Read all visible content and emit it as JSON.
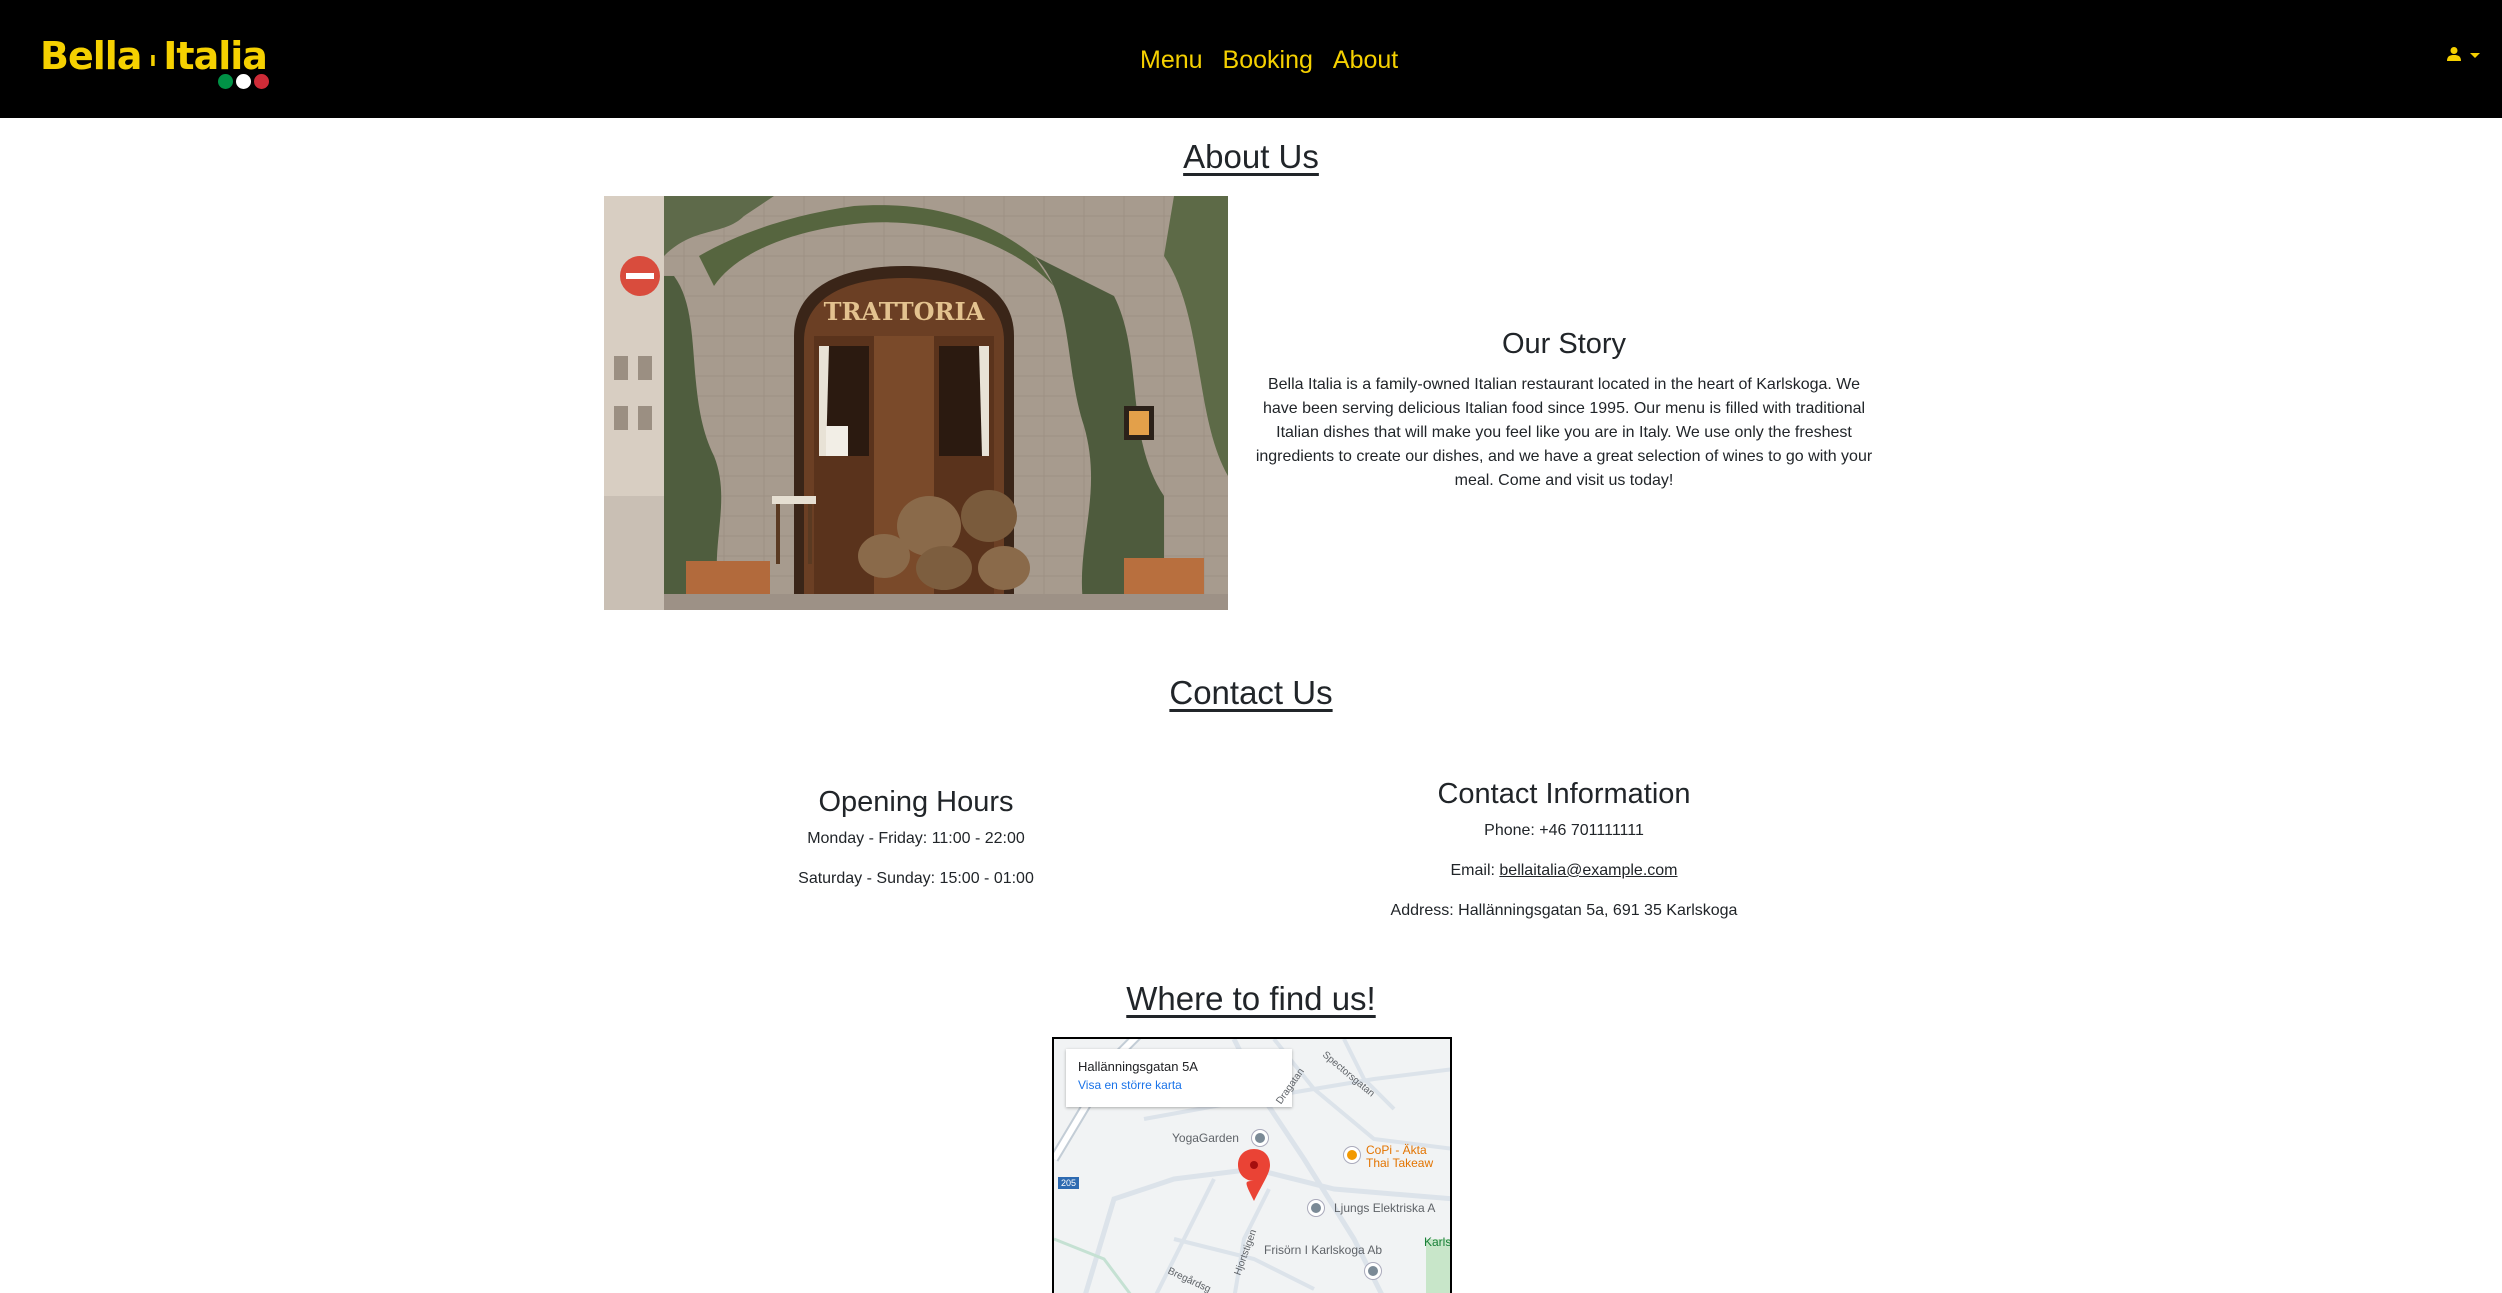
{
  "brand": {
    "name_part1": "Bella",
    "name_part2": "Italia",
    "colors": {
      "yellow": "#f5d000",
      "green": "#009246",
      "white": "#ffffff",
      "red": "#ce2b37"
    }
  },
  "nav": {
    "links": [
      {
        "label": "Menu"
      },
      {
        "label": "Booking"
      },
      {
        "label": "About"
      }
    ],
    "user_icon": "user-icon"
  },
  "about": {
    "title": "About Us",
    "image_alt": "Trattoria storefront",
    "image_sign": "TRATTORIA",
    "story_title": "Our Story",
    "story_text": "Bella Italia is a family-owned Italian restaurant located in the heart of Karlskoga. We have been serving delicious Italian food since 1995. Our menu is filled with traditional Italian dishes that will make you feel like you are in Italy. We use only the freshest ingredients to create our dishes, and we have a great selection of wines to go with your meal. Come and visit us today!"
  },
  "contact": {
    "title": "Contact Us",
    "hours_title": "Opening Hours",
    "hours": [
      "Monday - Friday: 11:00 - 22:00",
      "Saturday - Sunday: 15:00 - 01:00"
    ],
    "info_title": "Contact Information",
    "phone": "Phone: +46 701111111",
    "email_label": "Email: ",
    "email": "bellaitalia@example.com",
    "address": "Address: Hallänningsgatan 5a, 691 35 Karlskoga"
  },
  "map": {
    "title": "Where to find us!",
    "card_address": "Hallänningsgatan 5A",
    "card_link": "Visa en större karta",
    "labels": {
      "yoga": "YogaGarden",
      "copi": "CoPi - Äkta",
      "copi2": "Thai Takeaw",
      "ljungs": "Ljungs Elektriska A",
      "frisorn": "Frisörn I Karlskoga Ab",
      "karls": "Karls",
      "spector": "Spectorsgatan",
      "drag": "Dragatan",
      "hjort": "Hjortstigen",
      "bregard": "Bregårdsg",
      "road": "205"
    }
  }
}
